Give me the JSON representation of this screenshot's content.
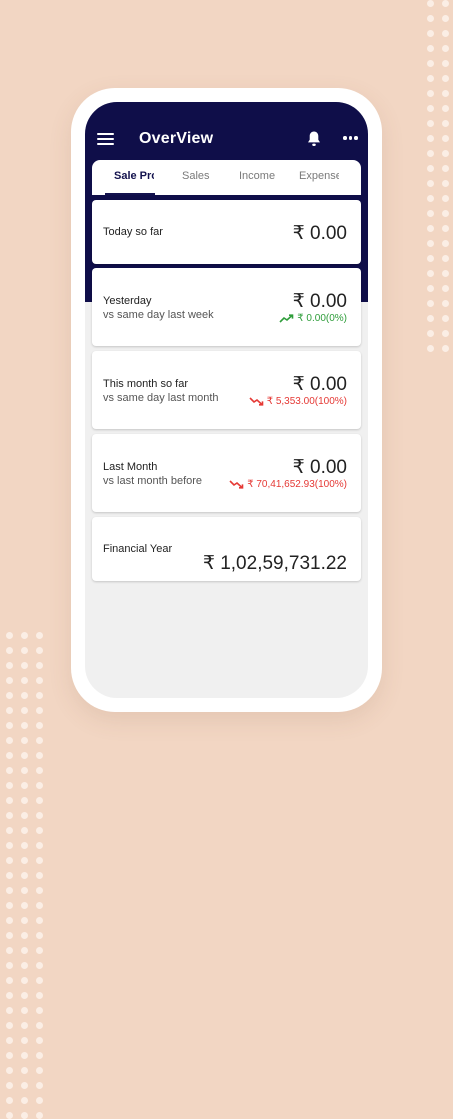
{
  "colors": {
    "background": "#f2d6c3",
    "header": "#0f0e49",
    "up": "#2e9d3a",
    "down": "#e53935"
  },
  "appbar": {
    "title": "OverView",
    "icons": [
      "menu-icon",
      "bell-icon",
      "more-icon"
    ]
  },
  "tabs": [
    {
      "label": "Sale Pro",
      "active": true
    },
    {
      "label": "Sales",
      "active": false
    },
    {
      "label": "Income",
      "active": false
    },
    {
      "label": "Expense",
      "active": false
    }
  ],
  "cards": {
    "today": {
      "label": "Today so far",
      "amount": "₹ 0.00"
    },
    "yesterday": {
      "label": "Yesterday",
      "sub": "vs same day last week",
      "amount": "₹ 0.00",
      "change": "₹ 0.00(0%)",
      "trend": "up"
    },
    "this_month": {
      "label": "This month so far",
      "sub": "vs same day last month",
      "amount": "₹ 0.00",
      "change": "₹ 5,353.00(100%)",
      "trend": "down"
    },
    "last_month": {
      "label": "Last Month",
      "sub": "vs last month before",
      "amount": "₹ 0.00",
      "change": "₹ 70,41,652.93(100%)",
      "trend": "down"
    },
    "financial_year": {
      "label": "Financial Year",
      "amount": "₹ 1,02,59,731.22"
    }
  }
}
